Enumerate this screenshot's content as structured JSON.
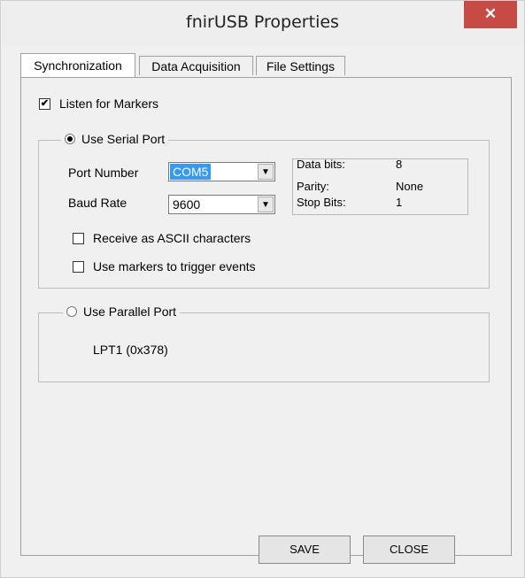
{
  "window": {
    "title": "fnirUSB Properties",
    "close_glyph": "✕"
  },
  "tabs": [
    {
      "label": "Synchronization",
      "active": true
    },
    {
      "label": "Data Acquisition",
      "active": false
    },
    {
      "label": "File Settings",
      "active": false
    }
  ],
  "sync": {
    "listen_markers": {
      "label": "Listen for Markers",
      "checked": true,
      "glyph": "✔"
    },
    "serial": {
      "label": "Use Serial Port",
      "selected": true,
      "port_label": "Port Number",
      "port_value": "COM5",
      "baud_label": "Baud Rate",
      "baud_value": "9600",
      "arrow_glyph": "▼",
      "info": {
        "data_bits_label": "Data bits:",
        "data_bits_value": "8",
        "parity_label": "Parity:",
        "parity_value": "None",
        "stop_bits_label": "Stop Bits:",
        "stop_bits_value": "1"
      },
      "ascii": {
        "label": "Receive as ASCII characters",
        "checked": false
      },
      "trigger": {
        "label": "Use markers to trigger events",
        "checked": false
      }
    },
    "parallel": {
      "label": "Use Parallel Port",
      "selected": false,
      "port": "LPT1 (0x378)"
    }
  },
  "buttons": {
    "save": "SAVE",
    "close": "CLOSE"
  },
  "colors": {
    "close_button": "#c84a45",
    "selection": "#3399ff",
    "background": "#f0f0f0"
  }
}
